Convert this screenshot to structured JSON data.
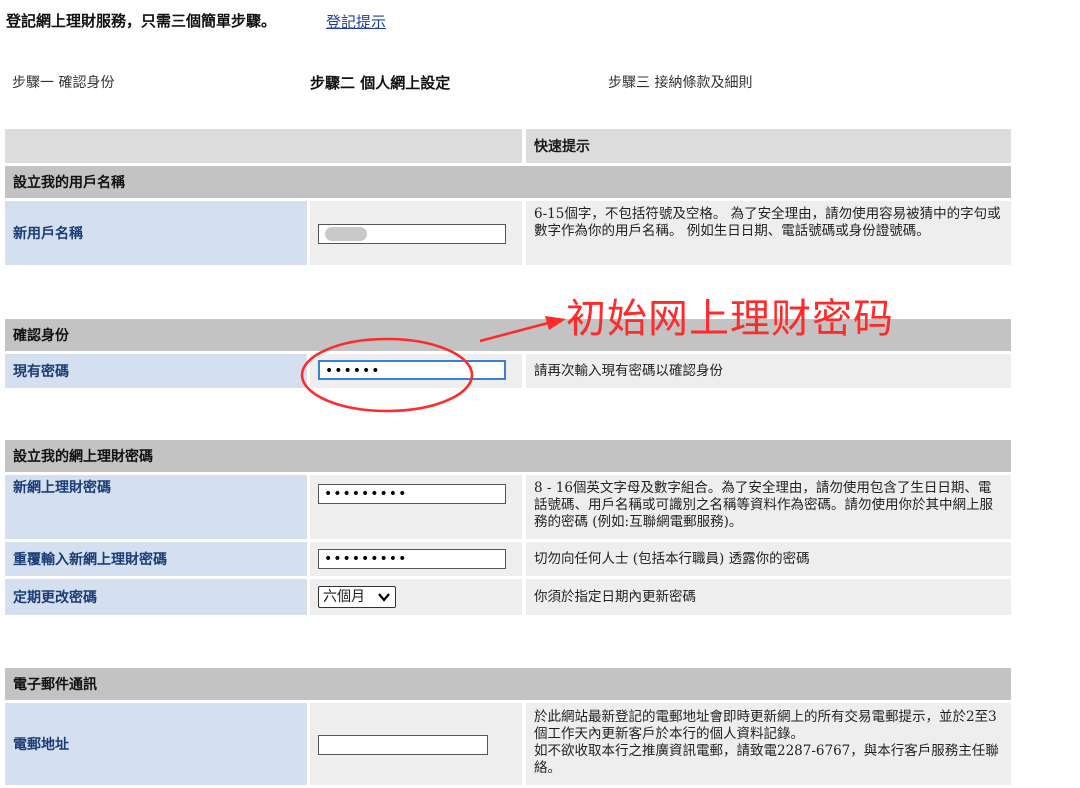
{
  "header": {
    "title": "登記網上理財服務，只需三個簡單步驟。",
    "help_link": "登記提示"
  },
  "steps": [
    {
      "label": "步驟一 確認身份",
      "active": false
    },
    {
      "label": "步驟二 個人網上設定",
      "active": true
    },
    {
      "label": "步驟三 接納條款及細則",
      "active": false
    }
  ],
  "quick_tips_header": "快速提示",
  "sections": {
    "username": {
      "title": "設立我的用戶名稱",
      "row_label": "新用戶名稱",
      "hint": "6-15個字，不包括符號及空格。 為了安全理由，請勿使用容易被猜中的字句或數字作為你的用戶名稱。 例如生日日期、電話號碼或身份證號碼。"
    },
    "verify": {
      "title": "確認身份",
      "row_label": "現有密碼",
      "value": "••••••",
      "hint": "請再次輸入現有密碼以確認身份"
    },
    "password": {
      "title": "設立我的網上理財密碼",
      "new_label": "新網上理財密碼",
      "new_value": "•••••••••",
      "new_hint": "8 - 16個英文字母及數字組合。為了安全理由，請勿使用包含了生日日期、電話號碼、用戶名稱或可識別之名稱等資料作為密碼。請勿使用你於其中網上服務的密碼 (例如:互聯網電郵服務)。",
      "repeat_label": "重覆輸入新網上理財密碼",
      "repeat_value": "•••••••••",
      "repeat_hint": "切勿向任何人士 (包括本行職員) 透露你的密碼",
      "period_label": "定期更改密碼",
      "period_value": "六個月",
      "period_hint": "你須於指定日期內更新密碼"
    },
    "email": {
      "title": "電子郵件通訊",
      "row_label": "電郵地址",
      "value": "",
      "hint": "於此網站最新登記的電郵地址會即時更新網上的所有交易電郵提示，並於2至3個工作天內更新客戶於本行的個人資料記錄。\n如不欲收取本行之推廣資訊電郵，請致電2287-6767，與本行客戶服務主任聯絡。"
    }
  },
  "annotation": {
    "text": "初始网上理财密码",
    "color": "#ff2a2a"
  },
  "colors": {
    "label_bg": "#d4e0ef",
    "section_bg": "#c3c3c3",
    "link": "#1c3f9a"
  }
}
